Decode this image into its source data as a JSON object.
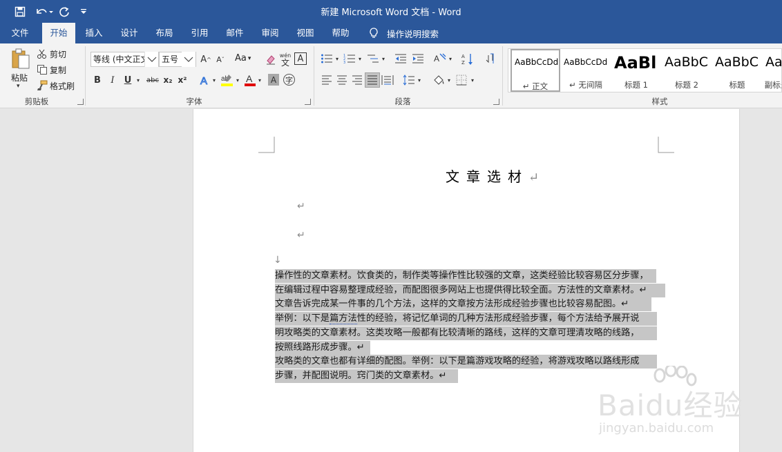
{
  "window": {
    "title": "新建 Microsoft Word 文档  -  Word"
  },
  "qat": {
    "save_icon": "save-icon",
    "undo_icon": "undo-icon",
    "redo_icon": "redo-icon",
    "customize_icon": "customize-qat-icon"
  },
  "tabs": [
    {
      "label": "文件"
    },
    {
      "label": "开始"
    },
    {
      "label": "插入"
    },
    {
      "label": "设计"
    },
    {
      "label": "布局"
    },
    {
      "label": "引用"
    },
    {
      "label": "邮件"
    },
    {
      "label": "审阅"
    },
    {
      "label": "视图"
    },
    {
      "label": "帮助"
    }
  ],
  "tell_me": {
    "label": "操作说明搜索"
  },
  "clipboard": {
    "paste": "粘贴",
    "cut": "剪切",
    "copy": "复制",
    "format_painter": "格式刷",
    "group": "剪贴板"
  },
  "font": {
    "name": "等线 (中文正文)",
    "size": "五号",
    "change_case": "Aa",
    "group": "字体",
    "bold": "B",
    "italic": "I",
    "underline": "U",
    "strike": "abc",
    "subscript": "x₂",
    "superscript": "x²",
    "wen": "wén",
    "big_a": "A"
  },
  "paragraph": {
    "group": "段落"
  },
  "styles": {
    "group": "样式",
    "items": [
      {
        "sample": "AaBbCcDd",
        "name": "↵ 正文"
      },
      {
        "sample": "AaBbCcDd",
        "name": "↵ 无间隔"
      },
      {
        "sample": "AaBl",
        "name": "标题 1"
      },
      {
        "sample": "AaBbC",
        "name": "标题 2"
      },
      {
        "sample": "AaBbC",
        "name": "标题"
      },
      {
        "sample": "AaI",
        "name": "副标题"
      }
    ]
  },
  "document": {
    "title": "文章选材",
    "return_mark": "↵",
    "line_break_mark": "↓",
    "lines": [
      "操作性的文章素材。饮食类的，制作类等操作性比较强的文章，这类经验比较容易区分步骤，",
      "在编辑过程中容易整理成经验，而配图很多网站上也提供得比较全面。方法性的文章素材。↵",
      "文章告诉完成某一件事的几个方法，这样的文章按方法形成经验步骤也比较容易配图。↵",
      "举例：以下是",
      "篇方法",
      "性的经验，将记忆单词的几种方法形成经验步骤，每个方法给予展开说",
      "明攻略类的文章素材。这类攻略一般都有比较清晰的路线，这样的文章可理清攻略的线路，",
      "按照线路形成步骤。↵",
      "攻略类的文章也都有详细的配图。举例：以下是篇游戏攻略的经验，将游戏攻略以路线形成",
      "步骤，并配图说明。窍门类的文章素材。↵"
    ]
  },
  "watermark": {
    "big": "Baidu经验",
    "small": "jingyan.baidu.com"
  }
}
